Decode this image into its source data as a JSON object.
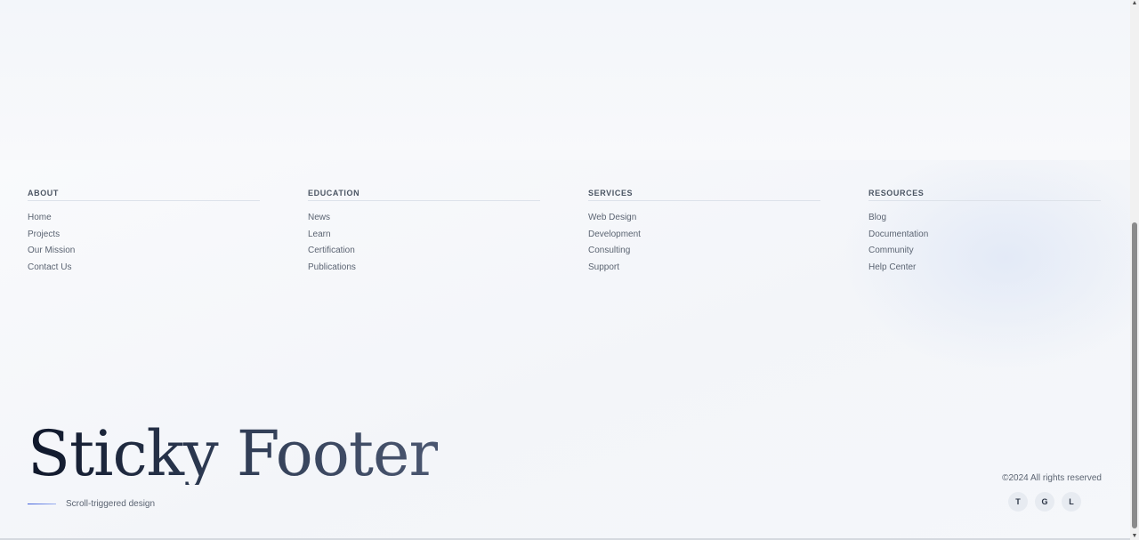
{
  "footer": {
    "columns": [
      {
        "heading": "ABOUT",
        "links": [
          "Home",
          "Projects",
          "Our Mission",
          "Contact Us"
        ]
      },
      {
        "heading": "EDUCATION",
        "links": [
          "News",
          "Learn",
          "Certification",
          "Publications"
        ]
      },
      {
        "heading": "SERVICES",
        "links": [
          "Web Design",
          "Development",
          "Consulting",
          "Support"
        ]
      },
      {
        "heading": "RESOURCES",
        "links": [
          "Blog",
          "Documentation",
          "Community",
          "Help Center"
        ]
      }
    ],
    "brand_title": "Sticky Footer",
    "tagline": "Scroll-triggered design",
    "copyright": "©2024 All rights reserved",
    "socials": [
      "T",
      "G",
      "L"
    ]
  },
  "scrollbar": {
    "up_icon": "scroll-up-arrow",
    "down_icon": "scroll-down-arrow"
  }
}
